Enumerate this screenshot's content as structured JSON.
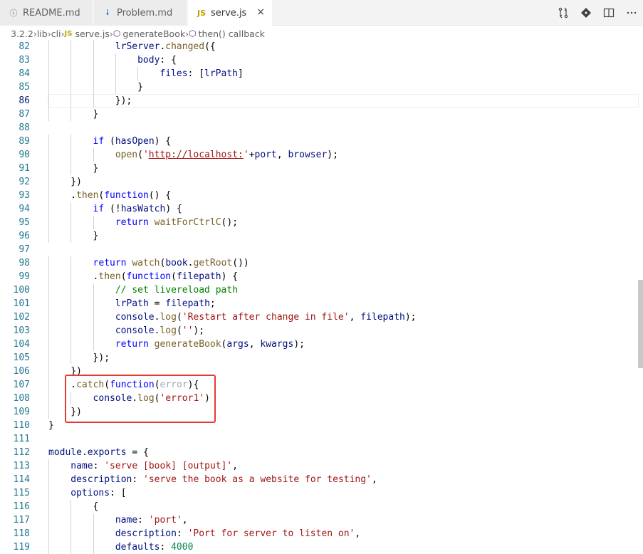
{
  "tabs": [
    {
      "label": "README.md",
      "icon": "info-icon"
    },
    {
      "label": "Problem.md",
      "icon": "markdown-icon"
    },
    {
      "label": "serve.js",
      "icon": "js-icon",
      "close": "×"
    }
  ],
  "editor_actions": [
    "compare-changes-icon",
    "git-lens-icon",
    "split-editor-icon",
    "more-actions-icon"
  ],
  "breadcrumbs": [
    "3.2.2",
    "lib",
    "cli",
    "serve.js",
    "generateBook",
    "then() callback"
  ],
  "js_badge": "JS",
  "lines": [
    {
      "no": "82",
      "indent": 3,
      "tokens": [
        [
          "v",
          "lrServer"
        ],
        [
          "",
          "."
        ],
        [
          "f",
          "changed"
        ],
        [
          "",
          "({"
        ]
      ]
    },
    {
      "no": "83",
      "indent": 4,
      "tokens": [
        [
          "v",
          "body"
        ],
        [
          "",
          ": {"
        ]
      ]
    },
    {
      "no": "84",
      "indent": 5,
      "tokens": [
        [
          "v",
          "files"
        ],
        [
          "",
          ": ["
        ],
        [
          "v",
          "lrPath"
        ],
        [
          "",
          "]"
        ]
      ]
    },
    {
      "no": "85",
      "indent": 4,
      "tokens": [
        [
          "",
          "}"
        ]
      ]
    },
    {
      "no": "86",
      "indent": 3,
      "tokens": [
        [
          "",
          "});"
        ]
      ],
      "current": true
    },
    {
      "no": "87",
      "indent": 2,
      "tokens": [
        [
          "",
          "}"
        ]
      ]
    },
    {
      "no": "88",
      "indent": 0,
      "tokens": []
    },
    {
      "no": "89",
      "indent": 2,
      "tokens": [
        [
          "k",
          "if"
        ],
        [
          "",
          " ("
        ],
        [
          "v",
          "hasOpen"
        ],
        [
          "",
          ") {"
        ]
      ]
    },
    {
      "no": "90",
      "indent": 3,
      "tokens": [
        [
          "f",
          "open"
        ],
        [
          "",
          "("
        ],
        [
          "s",
          "'"
        ],
        [
          "su",
          "http://localhost:"
        ],
        [
          "s",
          "'"
        ],
        [
          "",
          "+"
        ],
        [
          "v",
          "port"
        ],
        [
          "",
          ", "
        ],
        [
          "v",
          "browser"
        ],
        [
          "",
          ");"
        ]
      ]
    },
    {
      "no": "91",
      "indent": 2,
      "tokens": [
        [
          "",
          "}"
        ]
      ]
    },
    {
      "no": "92",
      "indent": 1,
      "tokens": [
        [
          "",
          "})"
        ]
      ]
    },
    {
      "no": "93",
      "indent": 1,
      "tokens": [
        [
          "",
          "."
        ],
        [
          "f",
          "then"
        ],
        [
          "",
          "("
        ],
        [
          "k",
          "function"
        ],
        [
          "",
          "() {"
        ]
      ]
    },
    {
      "no": "94",
      "indent": 2,
      "tokens": [
        [
          "k",
          "if"
        ],
        [
          "",
          " (!"
        ],
        [
          "v",
          "hasWatch"
        ],
        [
          "",
          ") {"
        ]
      ]
    },
    {
      "no": "95",
      "indent": 3,
      "tokens": [
        [
          "k",
          "return"
        ],
        [
          "",
          " "
        ],
        [
          "f",
          "waitForCtrlC"
        ],
        [
          "",
          "();"
        ]
      ]
    },
    {
      "no": "96",
      "indent": 2,
      "tokens": [
        [
          "",
          "}"
        ]
      ]
    },
    {
      "no": "97",
      "indent": 0,
      "tokens": []
    },
    {
      "no": "98",
      "indent": 2,
      "tokens": [
        [
          "k",
          "return"
        ],
        [
          "",
          " "
        ],
        [
          "f",
          "watch"
        ],
        [
          "",
          "("
        ],
        [
          "v",
          "book"
        ],
        [
          "",
          "."
        ],
        [
          "f",
          "getRoot"
        ],
        [
          "",
          "())"
        ]
      ]
    },
    {
      "no": "99",
      "indent": 2,
      "tokens": [
        [
          "",
          "."
        ],
        [
          "f",
          "then"
        ],
        [
          "",
          "("
        ],
        [
          "k",
          "function"
        ],
        [
          "",
          "("
        ],
        [
          "v",
          "filepath"
        ],
        [
          "",
          ") {"
        ]
      ]
    },
    {
      "no": "100",
      "indent": 3,
      "tokens": [
        [
          "c",
          "// set livereload path"
        ]
      ]
    },
    {
      "no": "101",
      "indent": 3,
      "tokens": [
        [
          "v",
          "lrPath"
        ],
        [
          "",
          " = "
        ],
        [
          "v",
          "filepath"
        ],
        [
          "",
          ";"
        ]
      ]
    },
    {
      "no": "102",
      "indent": 3,
      "tokens": [
        [
          "v",
          "console"
        ],
        [
          "",
          "."
        ],
        [
          "f",
          "log"
        ],
        [
          "",
          "("
        ],
        [
          "s",
          "'Restart after change in file'"
        ],
        [
          "",
          ", "
        ],
        [
          "v",
          "filepath"
        ],
        [
          "",
          ");"
        ]
      ]
    },
    {
      "no": "103",
      "indent": 3,
      "tokens": [
        [
          "v",
          "console"
        ],
        [
          "",
          "."
        ],
        [
          "f",
          "log"
        ],
        [
          "",
          "("
        ],
        [
          "s",
          "''"
        ],
        [
          "",
          ");"
        ]
      ]
    },
    {
      "no": "104",
      "indent": 3,
      "tokens": [
        [
          "k",
          "return"
        ],
        [
          "",
          " "
        ],
        [
          "f",
          "generateBook"
        ],
        [
          "",
          "("
        ],
        [
          "v",
          "args"
        ],
        [
          "",
          ", "
        ],
        [
          "v",
          "kwargs"
        ],
        [
          "",
          ");"
        ]
      ]
    },
    {
      "no": "105",
      "indent": 2,
      "tokens": [
        [
          "",
          "});"
        ]
      ]
    },
    {
      "no": "106",
      "indent": 1,
      "tokens": [
        [
          "",
          "})"
        ]
      ]
    },
    {
      "no": "107",
      "indent": 1,
      "tokens": [
        [
          "",
          "."
        ],
        [
          "f",
          "catch"
        ],
        [
          "",
          "("
        ],
        [
          "k",
          "function"
        ],
        [
          "",
          "("
        ],
        [
          "p",
          "error"
        ],
        [
          "",
          "){"
        ]
      ]
    },
    {
      "no": "108",
      "indent": 2,
      "tokens": [
        [
          "v",
          "console"
        ],
        [
          "",
          "."
        ],
        [
          "f",
          "log"
        ],
        [
          "",
          "("
        ],
        [
          "s",
          "'error1'"
        ],
        [
          "",
          ")"
        ]
      ]
    },
    {
      "no": "109",
      "indent": 1,
      "tokens": [
        [
          "",
          "})"
        ]
      ]
    },
    {
      "no": "110",
      "indent": 0,
      "tokens": [
        [
          "",
          "}"
        ]
      ]
    },
    {
      "no": "111",
      "indent": 0,
      "tokens": []
    },
    {
      "no": "112",
      "indent": 0,
      "tokens": [
        [
          "v",
          "module"
        ],
        [
          "",
          "."
        ],
        [
          "v",
          "exports"
        ],
        [
          "",
          " = {"
        ]
      ]
    },
    {
      "no": "113",
      "indent": 1,
      "tokens": [
        [
          "v",
          "name"
        ],
        [
          "",
          ": "
        ],
        [
          "s",
          "'serve [book] [output]'"
        ],
        [
          "",
          ","
        ]
      ]
    },
    {
      "no": "114",
      "indent": 1,
      "tokens": [
        [
          "v",
          "description"
        ],
        [
          "",
          ": "
        ],
        [
          "s",
          "'serve the book as a website for testing'"
        ],
        [
          "",
          ","
        ]
      ]
    },
    {
      "no": "115",
      "indent": 1,
      "tokens": [
        [
          "v",
          "options"
        ],
        [
          "",
          ": ["
        ]
      ]
    },
    {
      "no": "116",
      "indent": 2,
      "tokens": [
        [
          "",
          "{"
        ]
      ]
    },
    {
      "no": "117",
      "indent": 3,
      "tokens": [
        [
          "v",
          "name"
        ],
        [
          "",
          ": "
        ],
        [
          "s",
          "'port'"
        ],
        [
          "",
          ","
        ]
      ]
    },
    {
      "no": "118",
      "indent": 3,
      "tokens": [
        [
          "v",
          "description"
        ],
        [
          "",
          ": "
        ],
        [
          "s",
          "'Port for server to listen on'"
        ],
        [
          "",
          ","
        ]
      ]
    },
    {
      "no": "119",
      "indent": 3,
      "tokens": [
        [
          "v",
          "defaults"
        ],
        [
          "",
          ": "
        ],
        [
          "n",
          "4000"
        ]
      ]
    }
  ]
}
